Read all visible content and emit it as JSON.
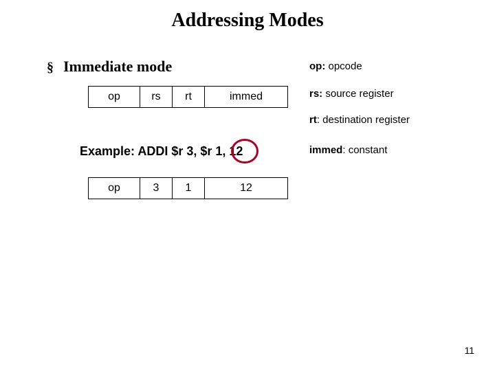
{
  "title": "Addressing Modes",
  "bullet_glyph": "§",
  "subhead": "Immediate mode",
  "format_row": {
    "op": "op",
    "rs": "rs",
    "rt": "rt",
    "immed": "immed"
  },
  "example_text": "Example: ADDI $r 3, $r 1, 12",
  "example_row": {
    "op": "op",
    "rs": "3",
    "rt": "1",
    "immed": "12"
  },
  "legend": {
    "op": {
      "key": "op:",
      "val": " opcode"
    },
    "rs": {
      "key": "rs:",
      "val": " source register"
    },
    "rt": {
      "key": "rt",
      "val": ": destination register"
    },
    "immed": {
      "key": "immed",
      "val": ": constant"
    }
  },
  "page_number": "11"
}
